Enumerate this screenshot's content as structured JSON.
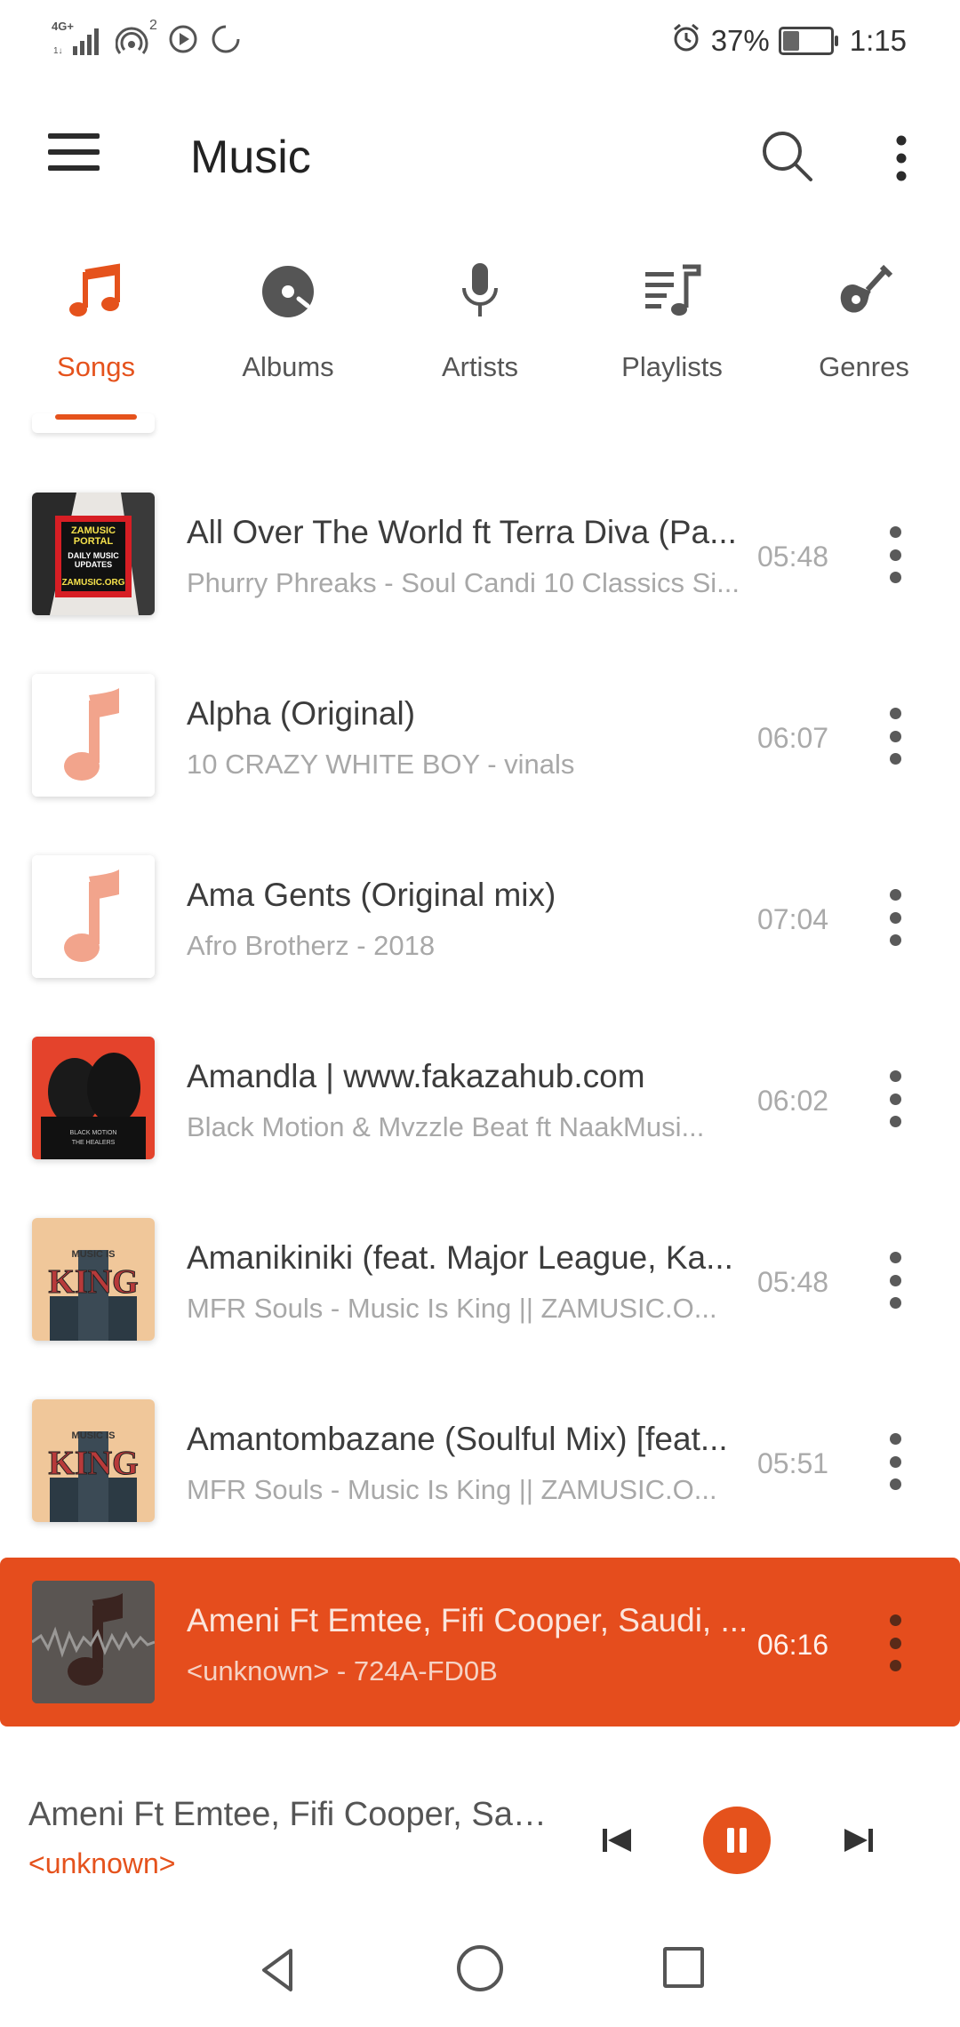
{
  "status": {
    "network": "4G+",
    "hotspot_badge": "2",
    "battery": "37%",
    "battery_level": 0.37,
    "time": "1:15"
  },
  "toolbar": {
    "title": "Music"
  },
  "tabs": [
    {
      "label": "Songs",
      "icon": "music-note-icon",
      "active": true
    },
    {
      "label": "Albums",
      "icon": "disc-icon",
      "active": false
    },
    {
      "label": "Artists",
      "icon": "microphone-icon",
      "active": false
    },
    {
      "label": "Playlists",
      "icon": "playlist-icon",
      "active": false
    },
    {
      "label": "Genres",
      "icon": "guitar-icon",
      "active": false
    }
  ],
  "songs": [
    {
      "title": "All Over The World ft Terra Diva (Pa...",
      "subtitle": "Phurry Phreaks - Soul Candi 10 Classics Si...",
      "duration": "05:48",
      "art": {
        "kind": "zamusic",
        "lines": [
          "ZAMUSIC",
          "PORTAL",
          "DAILY MUSIC",
          "UPDATES",
          "ZAMUSIC.ORG"
        ]
      }
    },
    {
      "title": "Alpha (Original)",
      "subtitle": "10 CRAZY WHITE BOY - vinals",
      "duration": "06:07",
      "art": {
        "kind": "placeholder"
      }
    },
    {
      "title": "Ama Gents (Original mix)",
      "subtitle": "Afro Brotherz - 2018",
      "duration": "07:04",
      "art": {
        "kind": "placeholder"
      }
    },
    {
      "title": "Amandla | www.fakazahub.com",
      "subtitle": "Black Motion & Mvzzle Beat ft NaakMusi...",
      "duration": "06:02",
      "art": {
        "kind": "healers",
        "lines": [
          "BLACK MOTION",
          "THE HEALERS"
        ]
      }
    },
    {
      "title": "Amanikiniki (feat. Major League, Ka...",
      "subtitle": "MFR Souls - Music Is King || ZAMUSIC.O...",
      "duration": "05:48",
      "art": {
        "kind": "king",
        "lines": [
          "MUSIC IS",
          "KING"
        ]
      }
    },
    {
      "title": "Amantombazane (Soulful Mix) [feat...",
      "subtitle": "MFR Souls - Music Is King || ZAMUSIC.O...",
      "duration": "05:51",
      "art": {
        "kind": "king",
        "lines": [
          "MUSIC IS",
          "KING"
        ]
      }
    },
    {
      "title": "Ameni Ft Emtee, Fifi Cooper, Saudi, ...",
      "subtitle": "<unknown> - 724A-FD0B",
      "duration": "06:16",
      "art": {
        "kind": "playing"
      },
      "playing": true
    }
  ],
  "now_playing": {
    "title": "Ameni Ft Emtee, Fifi Cooper, Sau...",
    "artist": "<unknown>"
  },
  "colors": {
    "accent": "#e5521c"
  }
}
